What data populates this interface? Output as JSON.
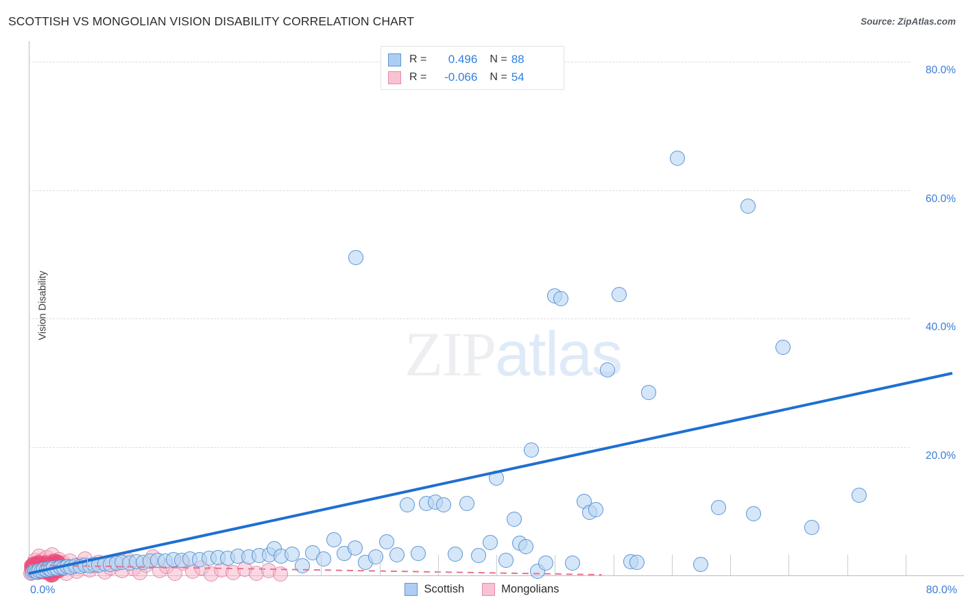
{
  "title": "SCOTTISH VS MONGOLIAN VISION DISABILITY CORRELATION CHART",
  "source": "Source: ZipAtlas.com",
  "watermark": {
    "part1": "ZIP",
    "part2": "atlas"
  },
  "stats": {
    "rows": [
      {
        "series": "Scottish",
        "r_label": "R =",
        "r": "0.496",
        "n_label": "N =",
        "n": "88",
        "color": "#aecdf2"
      },
      {
        "series": "Mongolians",
        "r_label": "R =",
        "r": "-0.066",
        "n_label": "N =",
        "n": "54",
        "color": "#f8c2d2"
      }
    ]
  },
  "legend": {
    "items": [
      {
        "label": "Scottish",
        "color": "#aecdf2"
      },
      {
        "label": "Mongolians",
        "color": "#f8c2d2"
      }
    ]
  },
  "axes": {
    "y_title": "Vision Disability",
    "y_ticks": [
      "80.0%",
      "60.0%",
      "40.0%",
      "20.0%"
    ],
    "x_min_label": "0.0%",
    "x_max_label": "80.0%"
  },
  "chart_data": {
    "type": "scatter",
    "title": "SCOTTISH VS MONGOLIAN VISION DISABILITY CORRELATION CHART",
    "xlabel": "",
    "ylabel": "Vision Disability",
    "xlim": [
      0,
      80
    ],
    "ylim": [
      0,
      84
    ],
    "x_unit": "%",
    "y_unit": "%",
    "grid": true,
    "y_gridlines": [
      20,
      40,
      60,
      80
    ],
    "legend_position": "bottom-center",
    "series": [
      {
        "name": "Scottish",
        "color": "#aecdf2",
        "edge_color": "#5b93d6",
        "r": 0.496,
        "n": 88,
        "trend": {
          "type": "linear",
          "x0": 0.0,
          "y0": 0.3,
          "x1": 79.0,
          "y1": 31.5,
          "style": "solid",
          "color": "#1f6fd0"
        },
        "points": [
          [
            0.3,
            0.4
          ],
          [
            0.5,
            0.6
          ],
          [
            0.7,
            0.5
          ],
          [
            0.9,
            0.8
          ],
          [
            1.1,
            0.7
          ],
          [
            1.3,
            1.0
          ],
          [
            1.5,
            0.9
          ],
          [
            1.7,
            1.1
          ],
          [
            1.9,
            1.0
          ],
          [
            2.1,
            1.2
          ],
          [
            2.4,
            1.1
          ],
          [
            2.7,
            1.3
          ],
          [
            3.0,
            1.2
          ],
          [
            3.3,
            1.4
          ],
          [
            3.6,
            1.3
          ],
          [
            4.0,
            1.5
          ],
          [
            4.4,
            1.4
          ],
          [
            4.8,
            1.6
          ],
          [
            5.2,
            1.5
          ],
          [
            5.6,
            1.7
          ],
          [
            6.0,
            1.6
          ],
          [
            6.5,
            1.8
          ],
          [
            7.0,
            1.7
          ],
          [
            7.5,
            1.9
          ],
          [
            8.0,
            2.0
          ],
          [
            8.6,
            1.9
          ],
          [
            9.2,
            2.1
          ],
          [
            9.8,
            2.0
          ],
          [
            10.4,
            2.2
          ],
          [
            11.0,
            2.3
          ],
          [
            11.7,
            2.2
          ],
          [
            12.4,
            2.5
          ],
          [
            13.1,
            2.4
          ],
          [
            13.8,
            2.6
          ],
          [
            14.6,
            2.5
          ],
          [
            15.4,
            2.7
          ],
          [
            16.2,
            2.8
          ],
          [
            17.0,
            2.7
          ],
          [
            17.9,
            3.0
          ],
          [
            18.8,
            2.9
          ],
          [
            19.7,
            3.1
          ],
          [
            20.6,
            3.2
          ],
          [
            21.0,
            4.2
          ],
          [
            21.6,
            3.0
          ],
          [
            22.5,
            3.3
          ],
          [
            23.4,
            1.5
          ],
          [
            24.3,
            3.5
          ],
          [
            25.2,
            2.6
          ],
          [
            26.1,
            5.5
          ],
          [
            27.0,
            3.4
          ],
          [
            27.9,
            4.3
          ],
          [
            28.8,
            2.0
          ],
          [
            29.7,
            2.9
          ],
          [
            30.6,
            5.2
          ],
          [
            31.5,
            3.2
          ],
          [
            32.4,
            11.0
          ],
          [
            33.3,
            3.4
          ],
          [
            34.0,
            11.2
          ],
          [
            34.8,
            11.4
          ],
          [
            35.5,
            11.0
          ],
          [
            36.5,
            3.3
          ],
          [
            37.5,
            11.2
          ],
          [
            38.5,
            3.1
          ],
          [
            39.5,
            5.1
          ],
          [
            40.0,
            15.2
          ],
          [
            40.8,
            2.3
          ],
          [
            41.5,
            8.8
          ],
          [
            42.0,
            5.0
          ],
          [
            42.5,
            4.5
          ],
          [
            43.0,
            19.5
          ],
          [
            43.5,
            0.6
          ],
          [
            44.2,
            1.9
          ],
          [
            45.0,
            43.5
          ],
          [
            45.5,
            43.1
          ],
          [
            46.5,
            1.9
          ],
          [
            47.5,
            11.5
          ],
          [
            48.0,
            9.8
          ],
          [
            48.5,
            10.2
          ],
          [
            49.5,
            32.0
          ],
          [
            50.5,
            43.8
          ],
          [
            51.5,
            2.1
          ],
          [
            52.0,
            2.0
          ],
          [
            53.0,
            28.5
          ],
          [
            55.5,
            65.0
          ],
          [
            57.5,
            1.7
          ],
          [
            59.0,
            10.6
          ],
          [
            61.5,
            57.5
          ],
          [
            62.0,
            9.6
          ],
          [
            64.5,
            35.5
          ],
          [
            67.0,
            7.5
          ],
          [
            71.0,
            12.5
          ],
          [
            28.0,
            49.5
          ]
        ]
      },
      {
        "name": "Mongolians",
        "color": "#f8c2d2",
        "edge_color": "#e58aa6",
        "r": -0.066,
        "n": 54,
        "trend": {
          "type": "linear",
          "x0": 0.0,
          "y0": 1.6,
          "x1": 49.0,
          "y1": 0.1,
          "style": "dashed",
          "color": "#e8708f"
        },
        "points": [
          [
            0.2,
            0.3
          ],
          [
            0.3,
            0.9
          ],
          [
            0.4,
            1.6
          ],
          [
            0.5,
            2.4
          ],
          [
            0.6,
            0.6
          ],
          [
            0.7,
            1.2
          ],
          [
            0.8,
            2.0
          ],
          [
            0.9,
            3.0
          ],
          [
            1.0,
            0.5
          ],
          [
            1.1,
            1.4
          ],
          [
            1.2,
            2.3
          ],
          [
            1.3,
            0.8
          ],
          [
            1.4,
            1.8
          ],
          [
            1.5,
            2.8
          ],
          [
            1.6,
            0.4
          ],
          [
            1.7,
            1.1
          ],
          [
            1.8,
            2.1
          ],
          [
            2.0,
            3.2
          ],
          [
            2.2,
            0.7
          ],
          [
            2.4,
            1.5
          ],
          [
            2.6,
            2.5
          ],
          [
            2.8,
            1.0
          ],
          [
            3.0,
            1.9
          ],
          [
            3.2,
            0.3
          ],
          [
            3.5,
            2.2
          ],
          [
            3.8,
            1.3
          ],
          [
            4.1,
            0.6
          ],
          [
            4.4,
            1.7
          ],
          [
            4.8,
            2.6
          ],
          [
            5.2,
            0.9
          ],
          [
            5.6,
            1.5
          ],
          [
            6.0,
            2.0
          ],
          [
            6.5,
            0.5
          ],
          [
            7.0,
            1.2
          ],
          [
            7.5,
            1.8
          ],
          [
            8.0,
            0.8
          ],
          [
            8.5,
            2.3
          ],
          [
            9.0,
            1.1
          ],
          [
            9.5,
            0.4
          ],
          [
            10.0,
            1.6
          ],
          [
            10.6,
            2.9
          ],
          [
            11.2,
            0.7
          ],
          [
            11.8,
            1.4
          ],
          [
            12.5,
            0.3
          ],
          [
            13.2,
            1.9
          ],
          [
            14.0,
            0.6
          ],
          [
            14.8,
            1.2
          ],
          [
            15.6,
            0.2
          ],
          [
            16.5,
            0.9
          ],
          [
            17.5,
            0.4
          ],
          [
            18.5,
            1.0
          ],
          [
            19.5,
            0.3
          ],
          [
            20.5,
            0.7
          ],
          [
            21.5,
            0.2
          ]
        ]
      }
    ]
  }
}
